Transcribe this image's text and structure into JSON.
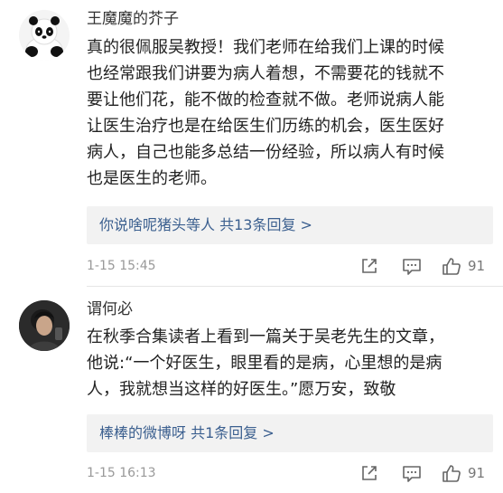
{
  "comments": [
    {
      "username": "王魔魔的芥子",
      "text_lines": [
        "真的很佩服吴教授！我们老师在给我们上课的时候",
        "也经常跟我们讲要为病人着想，不需要花的钱就不",
        "要让他们花，能不做的检查就不做。老师说病人能",
        "让医生治疗也是在给医生们历练的机会，医生医好",
        "病人，自己也能多总结一份经验，所以病人有时候",
        "也是医生的老师。"
      ],
      "reply_names": "你说啥呢猪头等人",
      "reply_count": "共13条回复 >",
      "timestamp": "1-15 15:45",
      "likes": "91",
      "avatar_icon": "panda-plush-avatar"
    },
    {
      "username": "谓何必",
      "text_lines": [
        "在秋季合集读者上看到一篇关于吴老先生的文章，",
        "他说:“一个好医生，眼里看的是病，心里想的是病",
        "人，我就想当这样的好医生。”愿万安，致敬"
      ],
      "reply_names": "棒棒的微博呀",
      "reply_count": "共1条回复 >",
      "timestamp": "1-15 16:13",
      "likes": "91",
      "avatar_icon": "person-photo-avatar"
    }
  ],
  "colors": {
    "link": "#3b5f8f",
    "meta": "#999999",
    "reply_bg": "#f2f2f2"
  }
}
